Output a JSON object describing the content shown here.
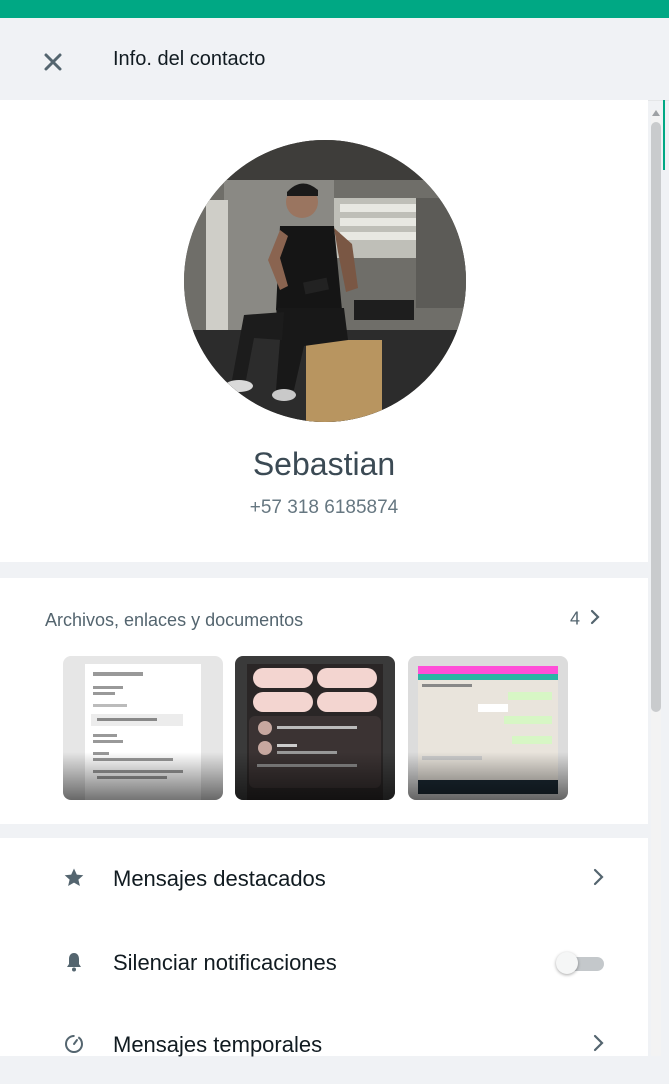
{
  "header": {
    "title": "Info. del contacto",
    "close_icon": "close-icon"
  },
  "profile": {
    "name": "Sebastian",
    "phone": "+57 318 6185874"
  },
  "media": {
    "title": "Archivos, enlaces y documentos",
    "count": "4",
    "thumbnails": [
      {
        "kind": "document-screenshot"
      },
      {
        "kind": "dark-app-screenshot"
      },
      {
        "kind": "chat-screenshot"
      }
    ]
  },
  "options": [
    {
      "label": "Mensajes destacados",
      "icon": "star-icon",
      "control": "chevron"
    },
    {
      "label": "Silenciar notificaciones",
      "icon": "bell-icon",
      "control": "toggle",
      "toggle_on": false
    },
    {
      "label": "Mensajes temporales",
      "icon": "timer-icon",
      "control": "chevron"
    }
  ],
  "colors": {
    "accent": "#00a884",
    "panel_bg": "#f0f2f5",
    "card_bg": "#ffffff",
    "secondary_text": "#667781"
  }
}
